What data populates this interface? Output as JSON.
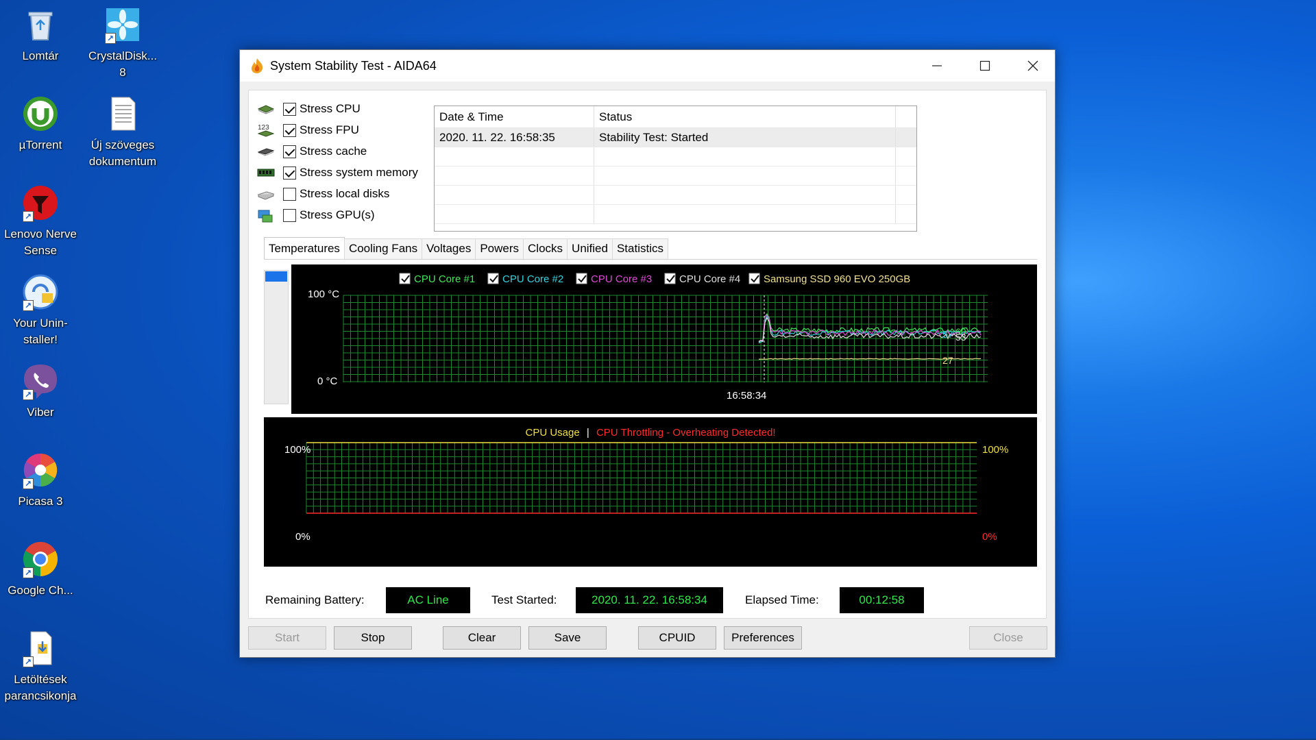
{
  "desktop": {
    "icons": [
      {
        "label": "Lomtár"
      },
      {
        "label": "CrystalDisk...\n8"
      },
      {
        "label": "µTorrent"
      },
      {
        "label": "Új szöveges dokumentum"
      },
      {
        "label": "Lenovo Nerve Sense"
      },
      {
        "label": "Your Unin-staller!"
      },
      {
        "label": "Viber"
      },
      {
        "label": "Picasa 3"
      },
      {
        "label": "Google Ch..."
      },
      {
        "label": "Letöltések parancsikonja"
      }
    ]
  },
  "window": {
    "title": "System Stability Test - AIDA64",
    "controls": {
      "minimize": "—",
      "maximize": "☐",
      "close": "✕"
    }
  },
  "stress_options": [
    {
      "label": "Stress CPU",
      "checked": true,
      "icon": "cpu-icon"
    },
    {
      "label": "Stress FPU",
      "checked": true,
      "icon": "fpu-icon"
    },
    {
      "label": "Stress cache",
      "checked": true,
      "icon": "cache-icon"
    },
    {
      "label": "Stress system memory",
      "checked": true,
      "icon": "memory-icon"
    },
    {
      "label": "Stress local disks",
      "checked": false,
      "icon": "disk-icon"
    },
    {
      "label": "Stress GPU(s)",
      "checked": false,
      "icon": "gpu-icon"
    }
  ],
  "log": {
    "headers": [
      "Date & Time",
      "Status"
    ],
    "rows": [
      [
        "2020. 11. 22. 16:58:35",
        "Stability Test: Started"
      ]
    ]
  },
  "tabs": [
    "Temperatures",
    "Cooling Fans",
    "Voltages",
    "Powers",
    "Clocks",
    "Unified",
    "Statistics"
  ],
  "active_tab": "Temperatures",
  "temp_chart": {
    "legend": [
      {
        "label": "CPU Core #1",
        "color": "#3fe85a",
        "checked": true
      },
      {
        "label": "CPU Core #2",
        "color": "#2fd6e0",
        "checked": true
      },
      {
        "label": "CPU Core #3",
        "color": "#e049d6",
        "checked": true
      },
      {
        "label": "CPU Core #4",
        "color": "#e0e0e0",
        "checked": true
      },
      {
        "label": "Samsung SSD 960 EVO 250GB",
        "color": "#f0e08c",
        "checked": true
      }
    ],
    "y_top_label": "100 °C",
    "y_bottom_label": "0 °C",
    "x_label": "16:58:34",
    "end_values": [
      "60",
      "57",
      "53",
      "27"
    ]
  },
  "usage_chart": {
    "title_usage": "CPU Usage",
    "separator": "|",
    "title_throttle": "CPU Throttling - Overheating Detected!",
    "left_top": "100%",
    "left_bottom": "0%",
    "right_top": "100%",
    "right_bottom": "0%"
  },
  "info": {
    "battery_label": "Remaining Battery:",
    "battery_value": "AC Line",
    "started_label": "Test Started:",
    "started_value": "2020. 11. 22. 16:58:34",
    "elapsed_label": "Elapsed Time:",
    "elapsed_value": "00:12:58"
  },
  "buttons": {
    "start": "Start",
    "stop": "Stop",
    "clear": "Clear",
    "save": "Save",
    "cpuid": "CPUID",
    "preferences": "Preferences",
    "close": "Close"
  },
  "chart_data": {
    "type": "line",
    "y_unit": "°C",
    "ylim": [
      0,
      100
    ],
    "x_marker": "16:58:34",
    "series": [
      {
        "name": "CPU Core #1",
        "color": "#3fe85a",
        "final_value": 60
      },
      {
        "name": "CPU Core #2",
        "color": "#2fd6e0",
        "final_value": 57
      },
      {
        "name": "CPU Core #3",
        "color": "#e049d6",
        "final_value": 57
      },
      {
        "name": "CPU Core #4",
        "color": "#e0e0e0",
        "final_value": 53
      },
      {
        "name": "Samsung SSD 960 EVO 250GB",
        "color": "#f0e08c",
        "final_value": 27
      }
    ],
    "cpu_usage": {
      "ylim": [
        0,
        100
      ],
      "value_percent": 100,
      "throttling_percent": 0
    }
  }
}
